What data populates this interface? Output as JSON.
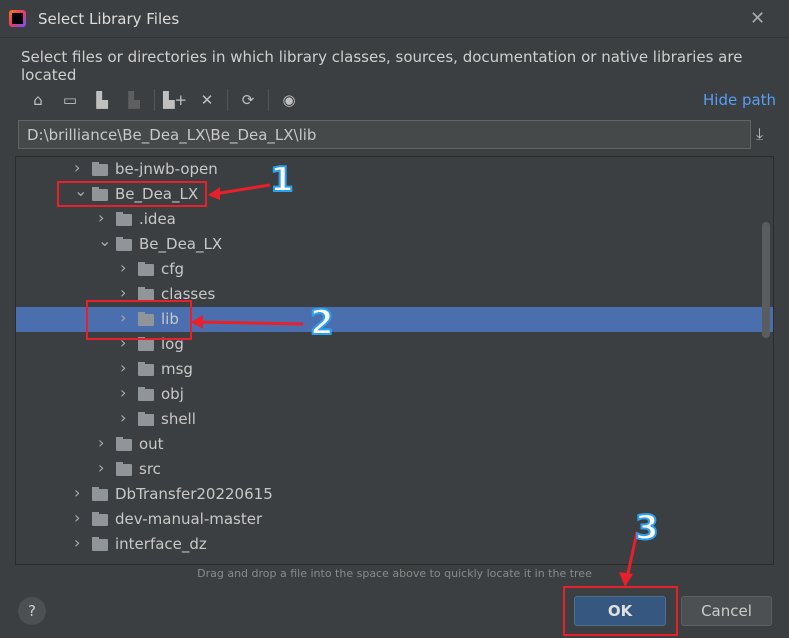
{
  "title": "Select Library Files",
  "description": "Select files or directories in which library classes, sources, documentation or native libraries are located",
  "toolbar": {
    "icons": [
      "home-icon",
      "desktop-icon",
      "project-folder-icon",
      "module-folder-icon",
      "new-folder-icon",
      "delete-icon",
      "refresh-icon",
      "show-hidden-icon"
    ],
    "hide_path": "Hide path"
  },
  "path": "D:\\brilliance\\Be_Dea_LX\\Be_Dea_LX\\lib",
  "tree": [
    {
      "label": "be-jnwb-open",
      "level": 0,
      "expanded": false
    },
    {
      "label": "Be_Dea_LX",
      "level": 0,
      "expanded": true
    },
    {
      "label": ".idea",
      "level": 1,
      "expanded": false
    },
    {
      "label": "Be_Dea_LX",
      "level": 1,
      "expanded": true
    },
    {
      "label": "cfg",
      "level": 2,
      "expanded": false
    },
    {
      "label": "classes",
      "level": 2,
      "expanded": false
    },
    {
      "label": "lib",
      "level": 2,
      "expanded": false,
      "selected": true
    },
    {
      "label": "log",
      "level": 2,
      "expanded": false
    },
    {
      "label": "msg",
      "level": 2,
      "expanded": false
    },
    {
      "label": "obj",
      "level": 2,
      "expanded": false
    },
    {
      "label": "shell",
      "level": 2,
      "expanded": false
    },
    {
      "label": "out",
      "level": 1,
      "expanded": false
    },
    {
      "label": "src",
      "level": 1,
      "expanded": false
    },
    {
      "label": "DbTransfer20220615",
      "level": 0,
      "expanded": false
    },
    {
      "label": "dev-manual-master",
      "level": 0,
      "expanded": false
    },
    {
      "label": "interface_dz",
      "level": 0,
      "expanded": false
    }
  ],
  "hint": "Drag and drop a file into the space above to quickly locate it in the tree",
  "buttons": {
    "help": "?",
    "ok": "OK",
    "cancel": "Cancel"
  },
  "annotations": [
    "1",
    "2",
    "3"
  ],
  "colors": {
    "selection": "#4b6eaf",
    "annotation": "#e8202a",
    "link": "#589df6"
  }
}
